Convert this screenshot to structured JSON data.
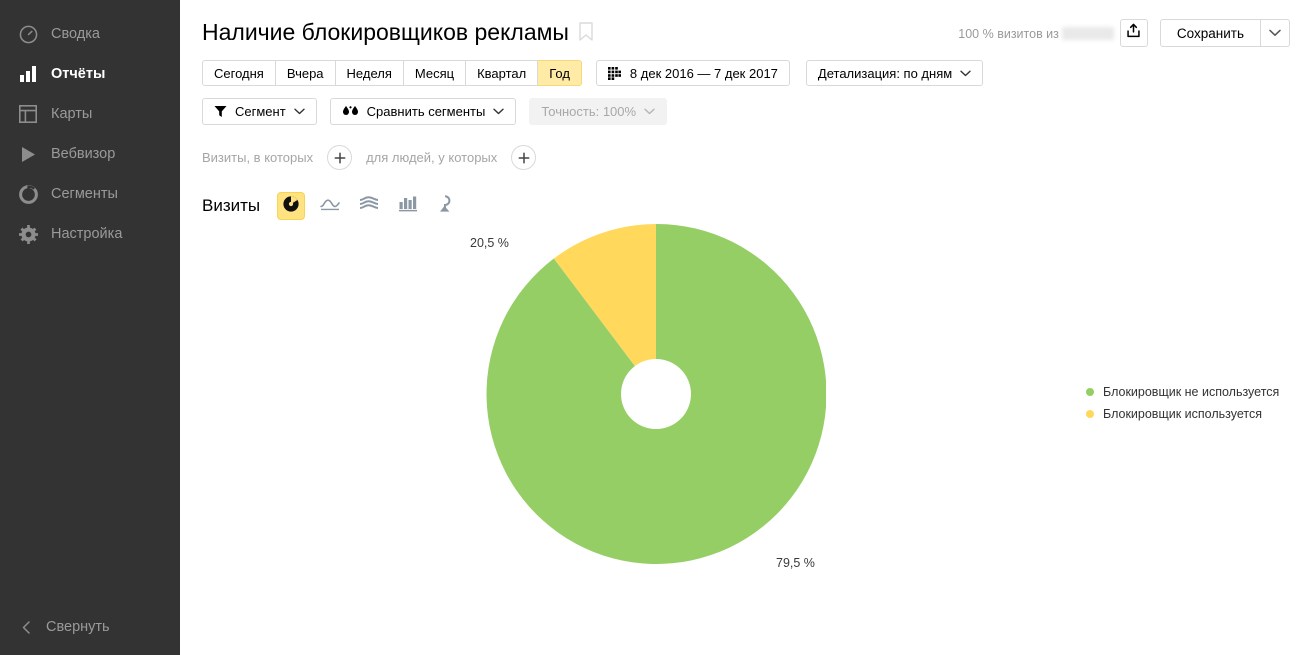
{
  "sidebar": {
    "items": [
      {
        "label": "Сводка",
        "icon": "gauge-icon",
        "active": false
      },
      {
        "label": "Отчёты",
        "icon": "bar-chart-icon",
        "active": true
      },
      {
        "label": "Карты",
        "icon": "layout-icon",
        "active": false
      },
      {
        "label": "Вебвизор",
        "icon": "play-icon",
        "active": false
      },
      {
        "label": "Сегменты",
        "icon": "donut-icon",
        "active": false
      },
      {
        "label": "Настройка",
        "icon": "gear-icon",
        "active": false
      }
    ],
    "collapse_label": "Свернуть"
  },
  "header": {
    "title": "Наличие блокировщиков рекламы",
    "visits_note": "100 % визитов из",
    "save_label": "Сохранить"
  },
  "period": {
    "tabs": [
      {
        "label": "Сегодня",
        "selected": false
      },
      {
        "label": "Вчера",
        "selected": false
      },
      {
        "label": "Неделя",
        "selected": false
      },
      {
        "label": "Месяц",
        "selected": false
      },
      {
        "label": "Квартал",
        "selected": false
      },
      {
        "label": "Год",
        "selected": true
      }
    ],
    "date_range": "8 дек 2016 — 7 дек 2017",
    "detail_label": "Детализация: по дням"
  },
  "segments": {
    "segment_label": "Сегмент",
    "compare_label": "Сравнить сегменты",
    "accuracy_label": "Точность: 100%"
  },
  "filters": {
    "visits_prefix": "Визиты, в которых",
    "people_prefix": "для людей, у которых"
  },
  "chart_toolbar": {
    "metric_label": "Визиты",
    "types": [
      {
        "name": "pie-chart-icon",
        "selected": true
      },
      {
        "name": "line-chart-icon",
        "selected": false
      },
      {
        "name": "area-chart-icon",
        "selected": false
      },
      {
        "name": "bar-chart-icon",
        "selected": false
      },
      {
        "name": "map-chart-icon",
        "selected": false
      }
    ]
  },
  "chart_data": {
    "type": "pie",
    "title": "Наличие блокировщиков рекламы",
    "categories": [
      "Блокировщик не используется",
      "Блокировщик используется"
    ],
    "values": [
      79.5,
      20.5
    ],
    "labels": [
      "79,5 %",
      "20,5 %"
    ],
    "colors": [
      "#95ce65",
      "#ffd85c"
    ],
    "unit": "%",
    "donut": true,
    "inner_radius_ratio": 0.205,
    "start_angle_deg": 0,
    "direction": "clockwise",
    "legend_position": "right",
    "grid": false,
    "xlabel": "",
    "ylabel": ""
  },
  "colors": {
    "accent_yellow": "#ffdb4d",
    "selected_tab_bg": "#ffeba5",
    "sidebar_bg": "#333333",
    "series_green": "#95ce65",
    "series_yellow": "#ffd85c"
  }
}
